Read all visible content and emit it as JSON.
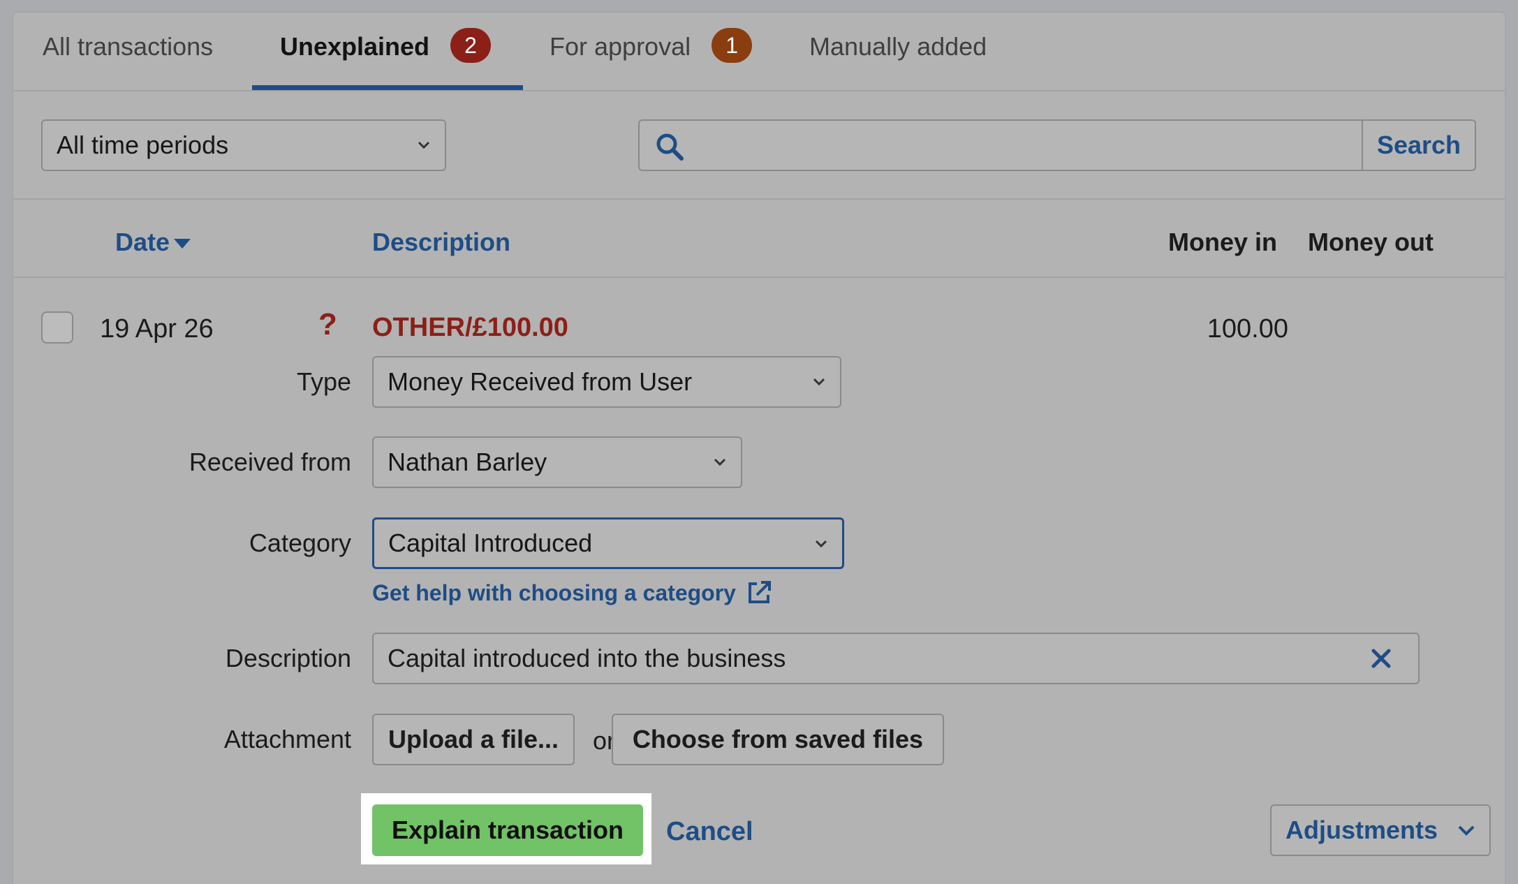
{
  "tabs": [
    {
      "label": "All transactions"
    },
    {
      "label": "Unexplained",
      "badge": "2"
    },
    {
      "label": "For approval",
      "badge": "1"
    },
    {
      "label": "Manually added"
    }
  ],
  "filters": {
    "period": "All time periods",
    "search_value": "",
    "search_button": "Search"
  },
  "columns": {
    "date": "Date",
    "description": "Description",
    "money_in": "Money in",
    "money_out": "Money out"
  },
  "transaction": {
    "date": "19 Apr 26",
    "status_symbol": "?",
    "description": "OTHER/£100.00",
    "money_in": "100.00",
    "money_out": ""
  },
  "form": {
    "type_label": "Type",
    "type_value": "Money Received from User",
    "received_from_label": "Received from",
    "received_from_value": "Nathan Barley",
    "category_label": "Category",
    "category_value": "Capital Introduced",
    "category_help": "Get help with choosing a category",
    "description_label": "Description",
    "description_value": "Capital introduced into the business",
    "attachment_label": "Attachment",
    "upload_button": "Upload a file...",
    "or_text": "or",
    "saved_files_button": "Choose from saved files",
    "explain_button": "Explain transaction",
    "cancel_link": "Cancel",
    "adjustments_button": "Adjustments"
  },
  "colors": {
    "link": "#1e4d86",
    "primary_button": "#72c267",
    "alert": "#8c1f17"
  }
}
